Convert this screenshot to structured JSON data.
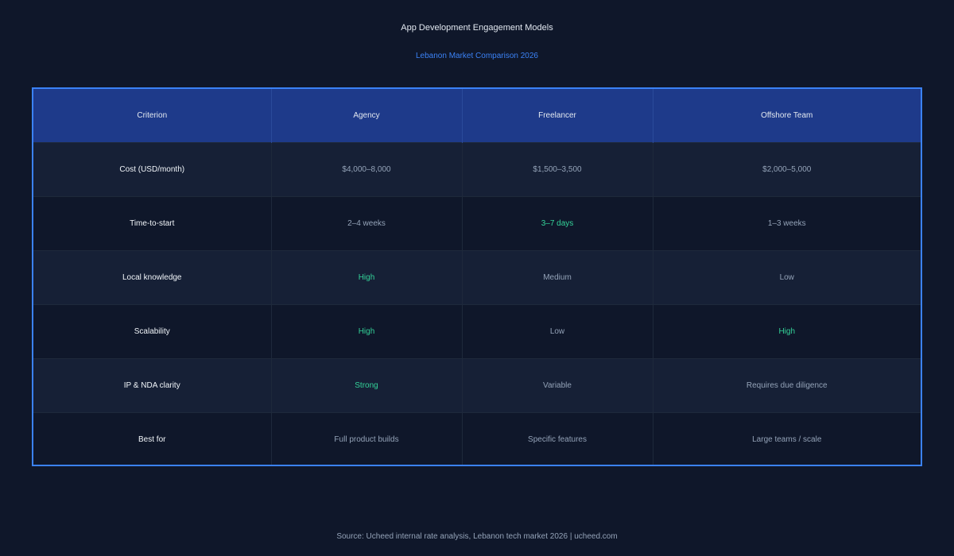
{
  "title": "App Development Engagement Models",
  "subtitle": "Lebanon Market Comparison 2026",
  "colors": {
    "background": "#0f172a",
    "header_bg": "#1e3a8a",
    "accent_border": "#3b82f6",
    "positive_text": "#34d399",
    "muted_text": "#94a3b8"
  },
  "chart_data": {
    "type": "table",
    "title": "App Development Engagement Models",
    "subtitle": "Lebanon Market Comparison 2026",
    "columns": [
      "Criterion",
      "Agency",
      "Freelancer",
      "Offshore Team"
    ],
    "rows": [
      {
        "criterion": "Cost (USD/month)",
        "cells": [
          {
            "text": "$4,000–8,000",
            "highlight": false
          },
          {
            "text": "$1,500–3,500",
            "highlight": false
          },
          {
            "text": "$2,000–5,000",
            "highlight": false
          }
        ]
      },
      {
        "criterion": "Time-to-start",
        "cells": [
          {
            "text": "2–4 weeks",
            "highlight": false
          },
          {
            "text": "3–7 days",
            "highlight": true
          },
          {
            "text": "1–3 weeks",
            "highlight": false
          }
        ]
      },
      {
        "criterion": "Local knowledge",
        "cells": [
          {
            "text": "High",
            "highlight": true
          },
          {
            "text": "Medium",
            "highlight": false
          },
          {
            "text": "Low",
            "highlight": false
          }
        ]
      },
      {
        "criterion": "Scalability",
        "cells": [
          {
            "text": "High",
            "highlight": true
          },
          {
            "text": "Low",
            "highlight": false
          },
          {
            "text": "High",
            "highlight": true
          }
        ]
      },
      {
        "criterion": "IP & NDA clarity",
        "cells": [
          {
            "text": "Strong",
            "highlight": true
          },
          {
            "text": "Variable",
            "highlight": false
          },
          {
            "text": "Requires due diligence",
            "highlight": false
          }
        ]
      },
      {
        "criterion": "Best for",
        "cells": [
          {
            "text": "Full product builds",
            "highlight": false
          },
          {
            "text": "Specific features",
            "highlight": false
          },
          {
            "text": "Large teams / scale",
            "highlight": false
          }
        ]
      }
    ]
  },
  "source": "Source: Ucheed internal rate analysis, Lebanon tech market 2026 | ucheed.com"
}
